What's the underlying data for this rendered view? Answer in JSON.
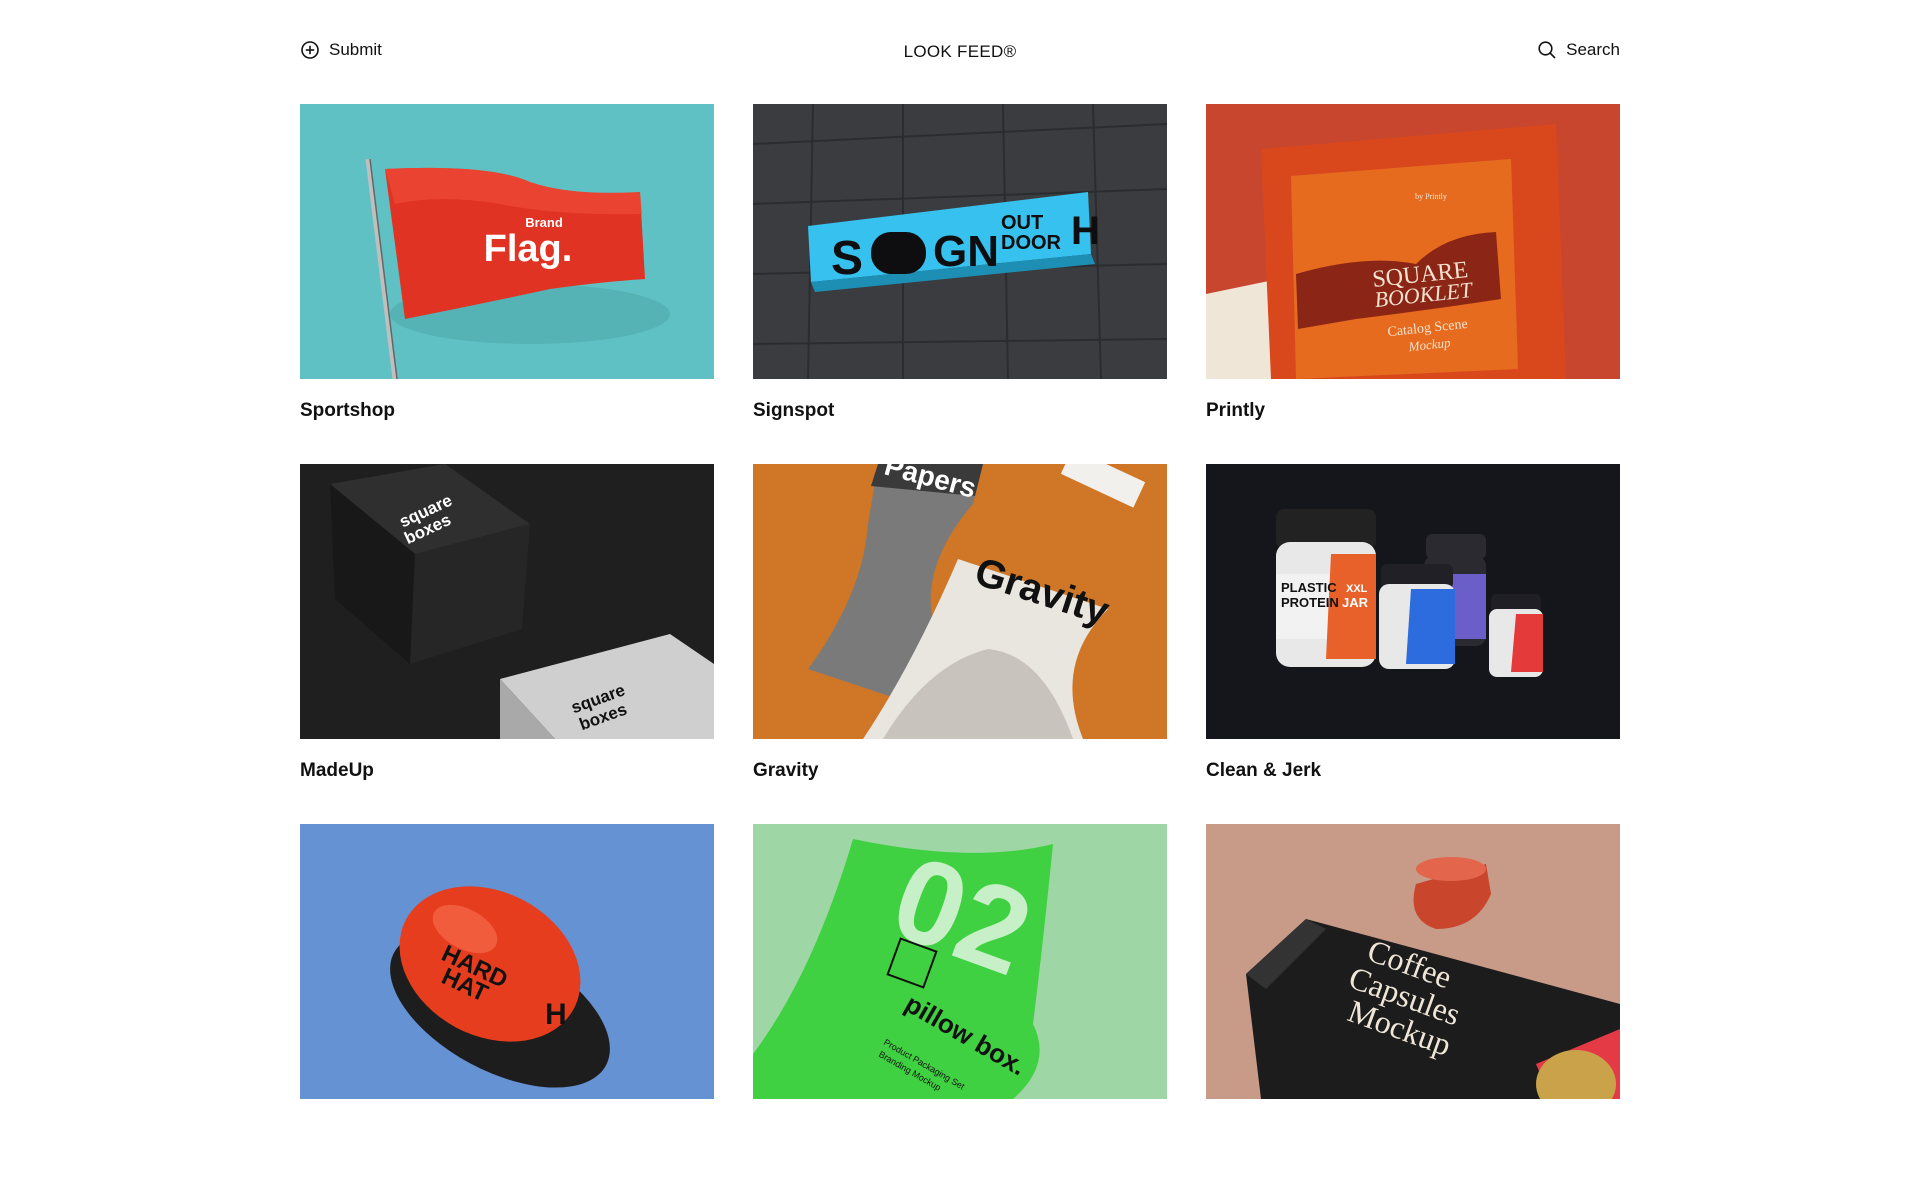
{
  "header": {
    "submit_label": "Submit",
    "brand": "LOOK FEED®",
    "search_label": "Search"
  },
  "cards": [
    {
      "title": "Sportshop",
      "thumb_text": [
        "Brand",
        "Flag."
      ]
    },
    {
      "title": "Signspot",
      "thumb_text": [
        "S",
        "GN",
        "OUT",
        "DOOR",
        "H"
      ]
    },
    {
      "title": "Printly",
      "thumb_text": [
        "by Printly",
        "SQUARE",
        "BOOKLET",
        "Catalog Scene",
        "Mockup"
      ]
    },
    {
      "title": "MadeUp",
      "thumb_text": [
        "square",
        "boxes"
      ]
    },
    {
      "title": "Gravity",
      "thumb_text": [
        "Papers",
        "Gravity"
      ]
    },
    {
      "title": "Clean & Jerk",
      "thumb_text": [
        "PLASTIC",
        "PROTEIN",
        "XXL",
        "JAR"
      ]
    },
    {
      "title": "",
      "thumb_text": [
        "HARD",
        "HAT",
        "H"
      ]
    },
    {
      "title": "",
      "thumb_text": [
        "02",
        "pillow box.",
        "Product Packaging Set",
        "Branding Mockup"
      ]
    },
    {
      "title": "",
      "thumb_text": [
        "Coffee",
        "Capsules",
        "Mockup"
      ]
    }
  ],
  "colors": {
    "sportshop_bg": "#5fc1c3",
    "signspot_bg": "#3a3c40",
    "printly_bg": "#c8452e",
    "madeup_bg": "#1f1f1f",
    "gravity_bg": "#cf7726",
    "cleanjerk_bg": "#15161c",
    "hardhat_bg": "#6592d2",
    "pillow_bg": "#9fd6a6",
    "coffee_bg": "#c89a88"
  },
  "icons": {
    "submit": "plus-circle-icon",
    "search": "search-icon"
  }
}
